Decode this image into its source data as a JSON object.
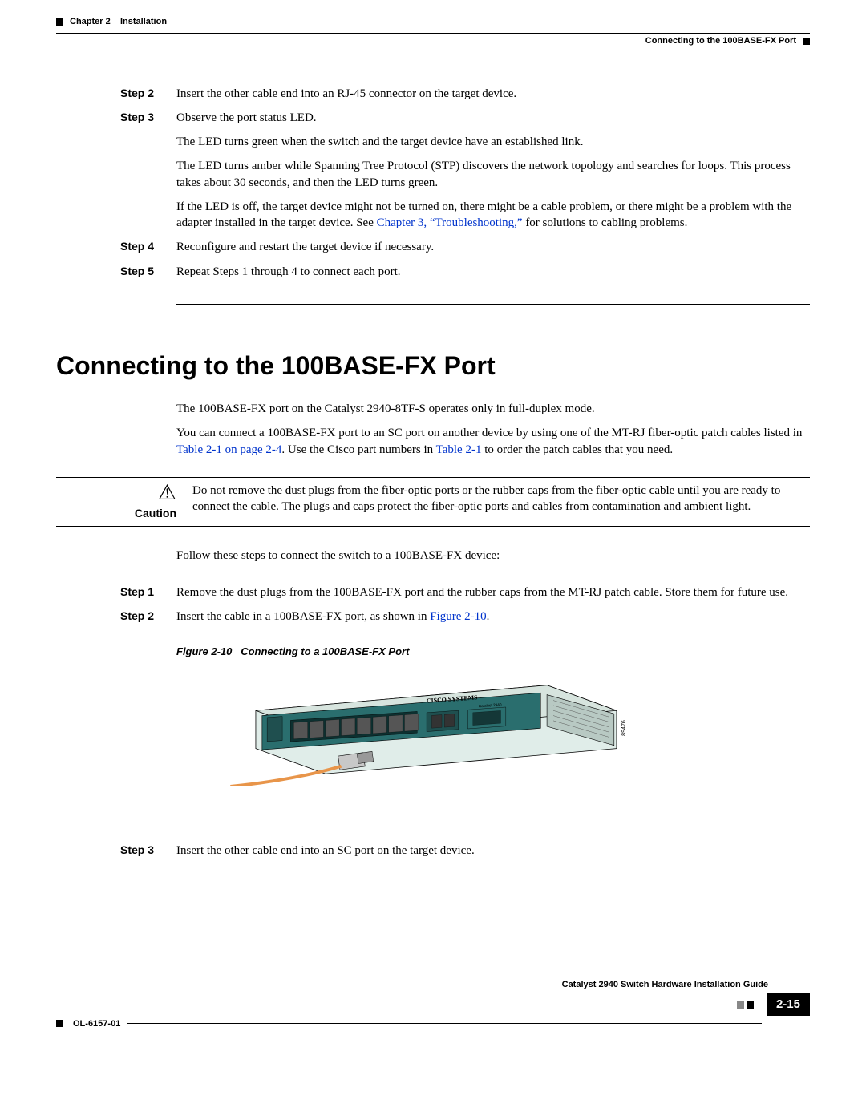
{
  "header": {
    "chapter_label": "Chapter 2",
    "chapter_title": "Installation",
    "section_right": "Connecting to the 100BASE-FX Port"
  },
  "steps_top": [
    {
      "label": "Step 2",
      "paras": [
        "Insert the other cable end into an RJ-45 connector on the target device."
      ]
    },
    {
      "label": "Step 3",
      "paras": [
        "Observe the port status LED.",
        "The LED turns green when the switch and the target device have an established link.",
        "The LED turns amber while Spanning Tree Protocol (STP) discovers the network topology and searches for loops. This process takes about 30 seconds, and then the LED turns green."
      ],
      "led_off_prefix": "If the LED is off, the target device might not be turned on, there might be a cable problem, or there might be a problem with the adapter installed in the target device. See ",
      "led_off_link": "Chapter 3, “Troubleshooting,”",
      "led_off_suffix": " for solutions to cabling problems."
    },
    {
      "label": "Step 4",
      "paras": [
        "Reconfigure and restart the target device if necessary."
      ]
    },
    {
      "label": "Step 5",
      "paras": [
        "Repeat Steps 1 through 4 to connect each port."
      ]
    }
  ],
  "section": {
    "title": "Connecting to the 100BASE-FX Port",
    "intro1": "The 100BASE-FX port on the Catalyst 2940-8TF-S operates only in full-duplex mode.",
    "intro2_pre": "You can connect a 100BASE-FX port to an SC port on another device by using one of the MT-RJ fiber-optic patch cables listed in ",
    "intro2_link1": "Table 2-1 on page 2-4",
    "intro2_mid": ". Use the Cisco part numbers in ",
    "intro2_link2": "Table 2-1",
    "intro2_post": " to order the patch cables that you need.",
    "caution_label": "Caution",
    "caution_text": "Do not remove the dust plugs from the fiber-optic ports or the rubber caps from the fiber-optic cable until you are ready to connect the cable. The plugs and caps protect the fiber-optic ports and cables from contamination and ambient light.",
    "follow_text": "Follow these steps to connect the switch to a 100BASE-FX device:",
    "figure_caption_num": "Figure 2-10",
    "figure_caption_text": "Connecting to a 100BASE-FX Port",
    "image_id": "89476",
    "switch_label": "Catalyst 2940",
    "cisco_brand": "CISCO SYSTEMS"
  },
  "steps_bottom": [
    {
      "label": "Step 1",
      "paras": [
        "Remove the dust plugs from the 100BASE-FX port and the rubber caps from the MT-RJ patch cable. Store them for future use."
      ]
    },
    {
      "label": "Step 2",
      "text_pre": "Insert the cable in a 100BASE-FX port, as shown in ",
      "link": "Figure 2-10",
      "text_post": "."
    },
    {
      "label": "Step 3",
      "paras": [
        "Insert the other cable end into an SC port on the target device."
      ]
    }
  ],
  "footer": {
    "doc_title": "Catalyst 2940 Switch Hardware Installation Guide",
    "page_num": "2-15",
    "doc_num": "OL-6157-01"
  }
}
